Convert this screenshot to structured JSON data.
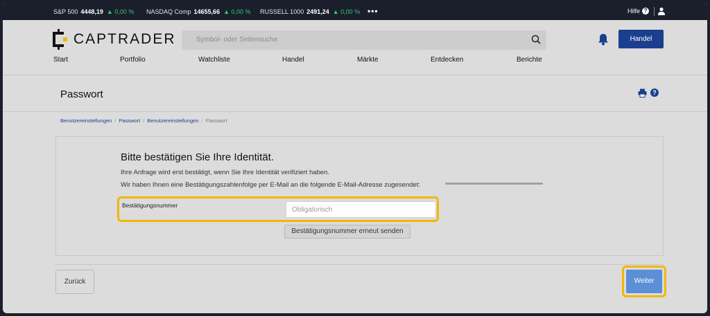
{
  "ticker": [
    {
      "name": "S&P 500",
      "value": "4448,19",
      "change": "▲ 0,00 %"
    },
    {
      "name": "NASDAQ Comp",
      "value": "14655,66",
      "change": "▲ 0,00 %"
    },
    {
      "name": "RUSSELL 1000",
      "value": "2491,24",
      "change": "▲ 0,00 %"
    }
  ],
  "top_right": {
    "help_label": "Hilfe",
    "help_glyph": "?"
  },
  "more_glyph": "•••",
  "logo_text": "CAPTRADER",
  "search": {
    "placeholder": "Symbol- oder Seitensuche"
  },
  "handel_button": "Handel",
  "nav": [
    "Start",
    "Portfolio",
    "Watchliste",
    "Handel",
    "Märkte",
    "Entdecken",
    "Berichte"
  ],
  "page_title": "Passwort",
  "breadcrumb": [
    "Benutzereinstellungen",
    "Passwort",
    "Benutzereinstellungen",
    "Passwort"
  ],
  "breadcrumb_sep": "/",
  "card": {
    "title": "Bitte bestätigen Sie Ihre Identität.",
    "line1": "Ihre Anfrage wird erst bestätigt, wenn Sie Ihre Identität verifiziert haben.",
    "line2": "Wir haben Ihnen eine Bestätigungszahlenfolge per E-Mail an die folgende E-Mail-Adresse zugesendet:",
    "field_label": "Bestätigungsnummer",
    "field_placeholder": "Obligatorisch",
    "resend_button": "Bestätigungsnummer erneut senden"
  },
  "footer": {
    "back_button": "Zurück",
    "next_button": "Weiter"
  },
  "colors": {
    "accent": "#1a3f8f",
    "highlight": "#f2b705",
    "positive": "#2ecc71",
    "primary_button": "#5b8fd6"
  }
}
